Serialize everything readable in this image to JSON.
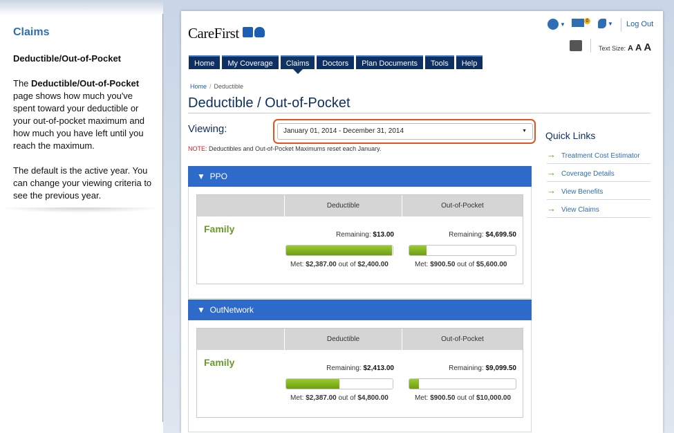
{
  "tutorial": {
    "title": "Claims",
    "subtitle": "Deductible/Out-of-Pocket",
    "para1_pre": "The ",
    "para1_bold": "Deductible/Out-of-Pocket",
    "para1_post": " page shows how much you've spent toward your deductible or your out-of-pocket maximum and how much you have left until you reach the maximum.",
    "para2": "The default is the active year. You can change your viewing criteria to see the previous year."
  },
  "header": {
    "logo_text": "CareFirst",
    "mail_badge": "0",
    "logout": "Log Out",
    "text_size_label": "Text Size:",
    "text_size_options": [
      "A",
      "A",
      "A"
    ]
  },
  "nav": {
    "items": [
      "Home",
      "My Coverage",
      "Claims",
      "Doctors",
      "Plan Documents",
      "Tools",
      "Help"
    ],
    "active": "Claims"
  },
  "breadcrumb": {
    "home": "Home",
    "sep": "/",
    "current": "Deductible"
  },
  "page_title": "Deductible / Out-of-Pocket",
  "viewing": {
    "label": "Viewing:",
    "selected": "January 01, 2014 - December 31, 2014"
  },
  "note": {
    "label": "NOTE:",
    "text": " Deductibles and Out-of-Pocket Maximums reset each January."
  },
  "plans": [
    {
      "name": "PPO",
      "col_deductible": "Deductible",
      "col_oop": "Out-of-Pocket",
      "member": "Family",
      "deductible": {
        "remaining_label": "Remaining:",
        "remaining": "$13.00",
        "met_label": "Met:",
        "met": "$2,387.00",
        "out_of": "out of",
        "max": "$2,400.00",
        "progress": 0.995
      },
      "oop": {
        "remaining_label": "Remaining:",
        "remaining": "$4,699.50",
        "met_label": "Met:",
        "met": "$900.50",
        "out_of": "out of",
        "max": "$5,600.00",
        "progress": 0.161
      }
    },
    {
      "name": "OutNetwork",
      "col_deductible": "Deductible",
      "col_oop": "Out-of-Pocket",
      "member": "Family",
      "deductible": {
        "remaining_label": "Remaining:",
        "remaining": "$2,413.00",
        "met_label": "Met:",
        "met": "$2,387.00",
        "out_of": "out of",
        "max": "$4,800.00",
        "progress": 0.497
      },
      "oop": {
        "remaining_label": "Remaining:",
        "remaining": "$9,099.50",
        "met_label": "Met:",
        "met": "$900.50",
        "out_of": "out of",
        "max": "$10,000.00",
        "progress": 0.09
      }
    }
  ],
  "quick_links": {
    "title": "Quick Links",
    "items": [
      "Treatment Cost Estimator",
      "Coverage Details",
      "View Benefits",
      "View Claims"
    ]
  },
  "colors": {
    "nav_bg": "#0e2f61",
    "plan_header": "#2e6ac9",
    "progress_fill": "#7aa91c",
    "highlight_outline": "#e2541f",
    "member_green": "#6a9a2a"
  }
}
